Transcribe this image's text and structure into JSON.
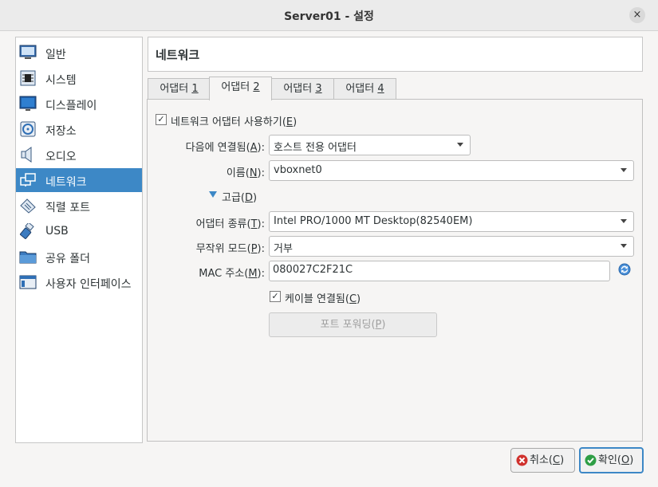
{
  "window": {
    "title": "Server01 - 설정",
    "close_icon": "×"
  },
  "sidebar": {
    "items": [
      {
        "label": "일반",
        "icon": "monitor-icon"
      },
      {
        "label": "시스템",
        "icon": "chip-icon"
      },
      {
        "label": "디스플레이",
        "icon": "display-icon"
      },
      {
        "label": "저장소",
        "icon": "storage-icon"
      },
      {
        "label": "오디오",
        "icon": "speaker-icon"
      },
      {
        "label": "네트워크",
        "icon": "network-icon",
        "selected": true
      },
      {
        "label": "직렬 포트",
        "icon": "serial-port-icon"
      },
      {
        "label": "USB",
        "icon": "usb-icon"
      },
      {
        "label": "공유 폴더",
        "icon": "folder-icon"
      },
      {
        "label": "사용자 인터페이스",
        "icon": "ui-icon"
      }
    ]
  },
  "header": {
    "title": "네트워크"
  },
  "tabs": [
    {
      "label": "어댑터 ",
      "key": "1"
    },
    {
      "label": "어댑터 ",
      "key": "2",
      "active": true
    },
    {
      "label": "어댑터 ",
      "key": "3"
    },
    {
      "label": "어댑터 ",
      "key": "4"
    }
  ],
  "form": {
    "enable_adapter": {
      "label": "네트워크 어댑터 사용하기(",
      "key": "E",
      "suffix": ")",
      "checked": true,
      "check_glyph": "✓"
    },
    "attached_to": {
      "label": "다음에 연결됨(",
      "key": "A",
      "suffix": "):",
      "value": "호스트 전용 어댑터"
    },
    "name": {
      "label": "이름(",
      "key": "N",
      "suffix": "):",
      "value": "vboxnet0"
    },
    "advanced": {
      "label": "고급(",
      "key": "D",
      "suffix": ")"
    },
    "adapter_type": {
      "label": "어댑터 종류(",
      "key": "T",
      "suffix": "):",
      "value": "Intel PRO/1000 MT Desktop(82540EM)"
    },
    "promiscuous_mode": {
      "label": "무작위 모드(",
      "key": "P",
      "suffix": "):",
      "value": "거부"
    },
    "mac_address": {
      "label": "MAC 주소(",
      "key": "M",
      "suffix": "):",
      "value": "080027C2F21C"
    },
    "cable_connected": {
      "label": "케이블 연결됨(",
      "key": "C",
      "suffix": ")",
      "checked": true,
      "check_glyph": "✓"
    },
    "port_forwarding": {
      "label": "포트 포워딩(",
      "key": "P",
      "suffix": ")"
    }
  },
  "footer": {
    "cancel": {
      "label": "취소(",
      "key": "C",
      "suffix": ")"
    },
    "ok": {
      "label": "확인(",
      "key": "O",
      "suffix": ")"
    }
  },
  "colors": {
    "accent": "#3d88c6",
    "cancel_red": "#d0312d",
    "ok_green": "#2e9e45"
  }
}
